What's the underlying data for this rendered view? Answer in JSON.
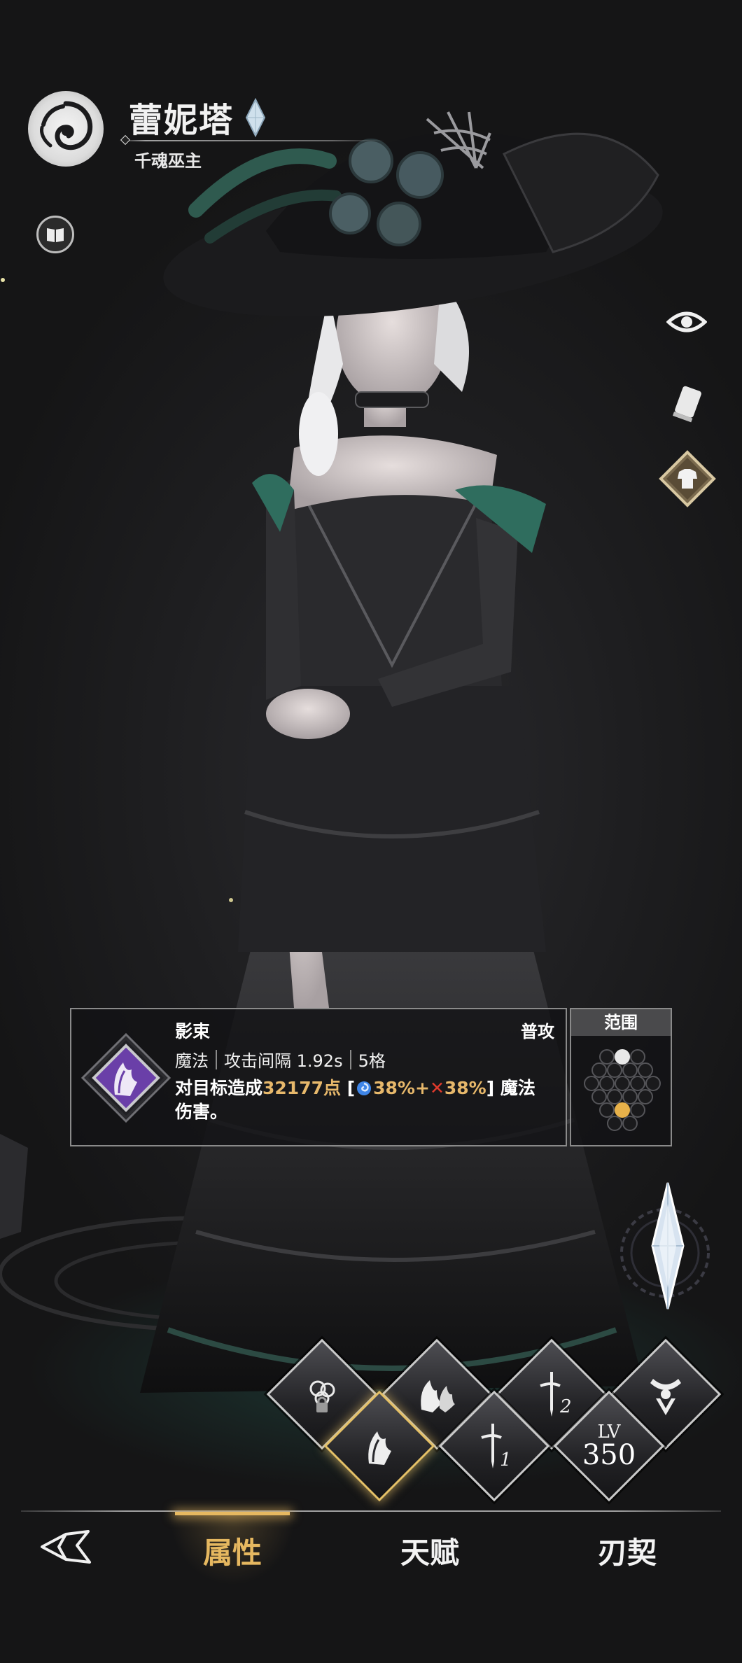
{
  "hero": {
    "name": "蕾妮塔",
    "subtitle": "千魂巫主"
  },
  "skill": {
    "name": "影束",
    "type": "普攻",
    "element": "魔法",
    "interval": "攻击间隔 1.92s",
    "range_cells": "5格",
    "desc_prefix": "对目标造成",
    "damage": "32177点",
    "bracket_open": " [",
    "scale_magic": "38%+",
    "scale_phys": "38%",
    "bracket_close": "] 魔法",
    "desc_line2": "伤害。"
  },
  "range": {
    "label": "范围"
  },
  "level": {
    "label": "LV",
    "value": "350"
  },
  "nav": {
    "tab_attributes": "属性",
    "tab_talent": "天赋",
    "tab_blade_contract": "刃契",
    "active": "属性"
  },
  "colors": {
    "accent_gold": "#e6b860",
    "damage_gold": "#e7b86b",
    "phys_red": "#e03a2c",
    "magic_blue": "#3f86e8"
  },
  "icons": {
    "emblem": "swirl-emblem-icon",
    "book": "book-icon",
    "eye": "eye-icon",
    "card": "card-icon",
    "outfit": "outfit-icon",
    "skill": "shadow-beam-skill-icon",
    "back": "back-arrow-icon"
  }
}
